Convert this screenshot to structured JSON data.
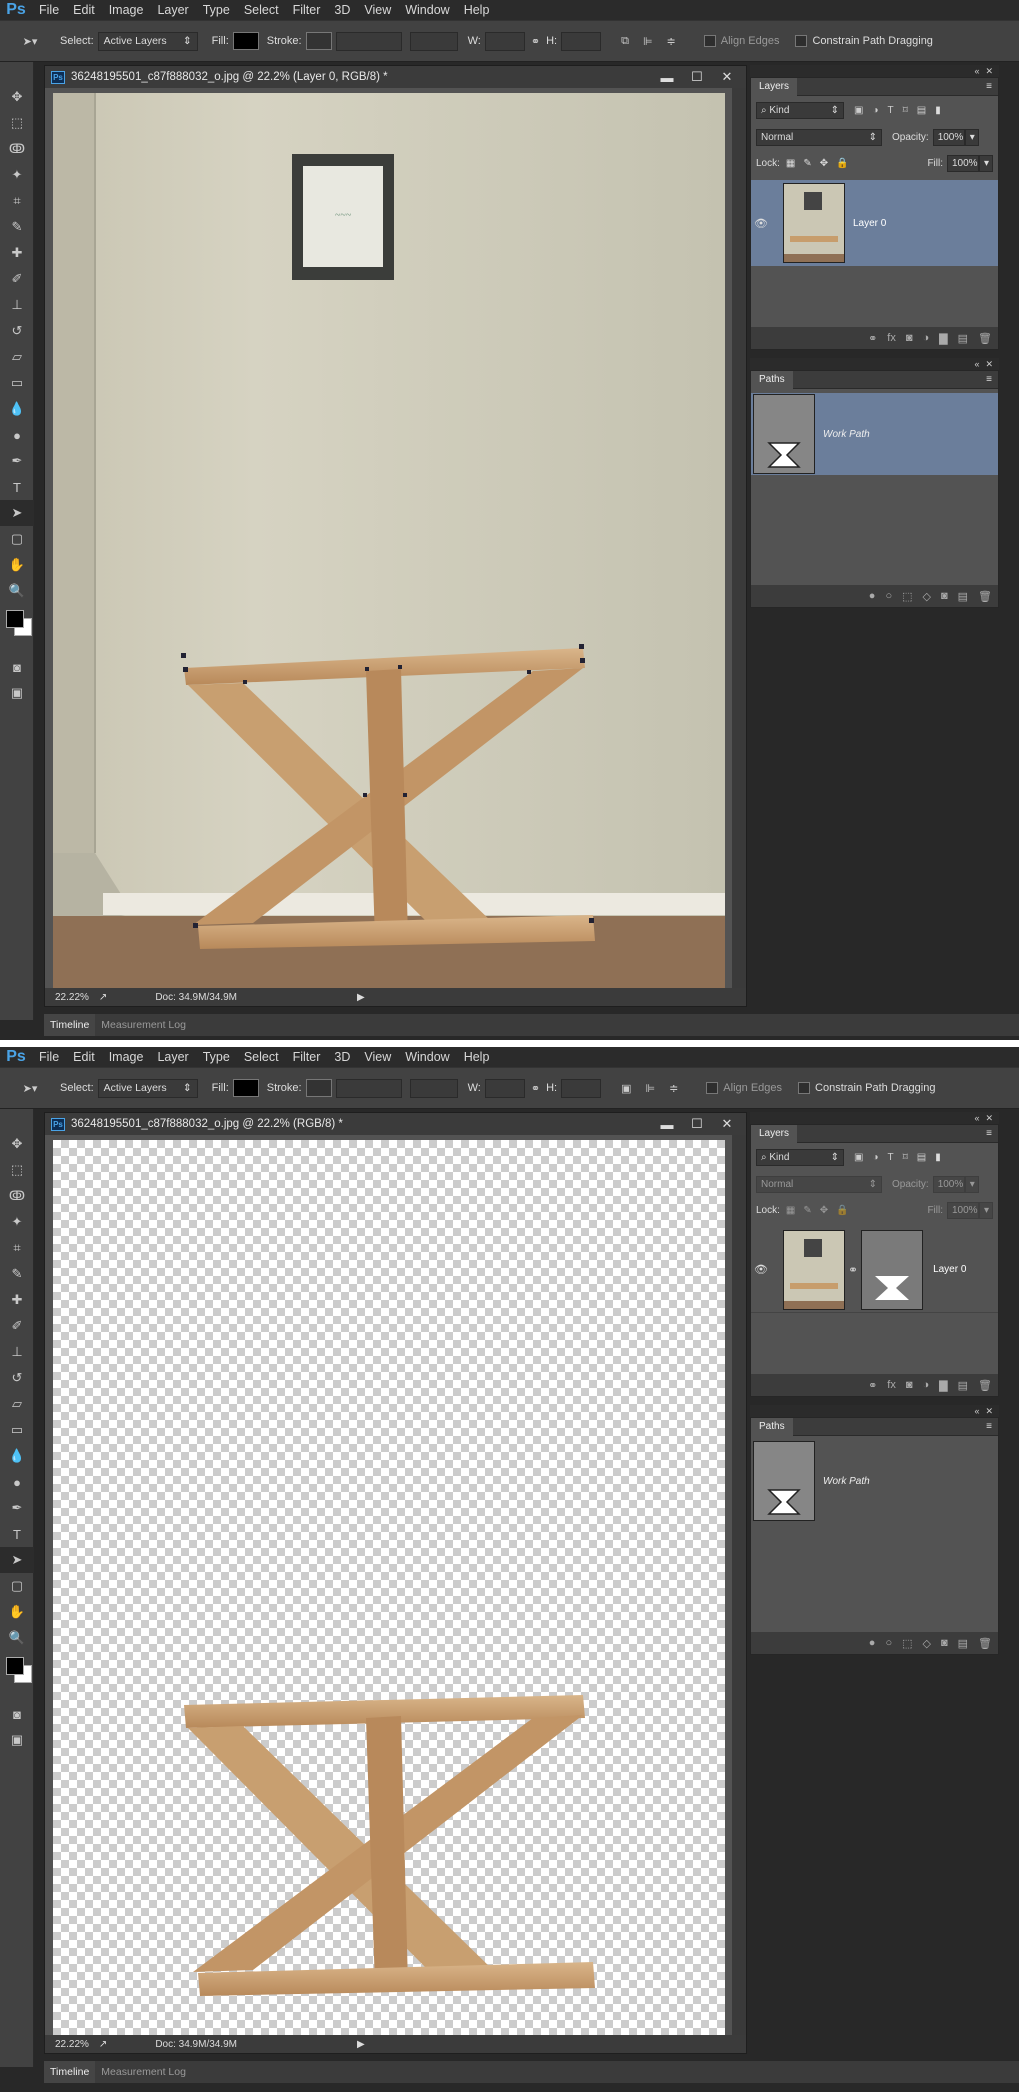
{
  "menu": [
    "File",
    "Edit",
    "Image",
    "Layer",
    "Type",
    "Select",
    "Filter",
    "3D",
    "View",
    "Window",
    "Help"
  ],
  "app_logo": "Ps",
  "options": {
    "select_label": "Select:",
    "select_value": "Active Layers",
    "fill_label": "Fill:",
    "stroke_label": "Stroke:",
    "w_label": "W:",
    "h_label": "H:",
    "align_edges": "Align Edges",
    "constrain": "Constrain Path Dragging"
  },
  "shot1": {
    "doc_title": "36248195501_c87f888032_o.jpg @ 22.2% (Layer 0, RGB/8) *",
    "zoom": "22.22%",
    "doc_size": "Doc: 34.9M/34.9M",
    "layers": {
      "kind": "Kind",
      "blend": "Normal",
      "opacity_label": "Opacity:",
      "opacity": "100%",
      "lock_label": "Lock:",
      "fill_label": "Fill:",
      "fill": "100%",
      "layer_name": "Layer 0"
    },
    "paths": {
      "tab": "Paths",
      "path_name": "Work Path"
    }
  },
  "shot2": {
    "doc_title": "36248195501_c87f888032_o.jpg @ 22.2% (RGB/8) *",
    "zoom": "22.22%",
    "doc_size": "Doc: 34.9M/34.9M",
    "layers": {
      "kind": "Kind",
      "blend": "Normal",
      "opacity_label": "Opacity:",
      "opacity": "100%",
      "lock_label": "Lock:",
      "fill_label": "Fill:",
      "fill": "100%",
      "layer_name": "Layer 0"
    },
    "paths": {
      "tab": "Paths",
      "path_name": "Work Path"
    }
  },
  "panels": {
    "layers_tab": "Layers"
  },
  "bottom_tabs": [
    "Timeline",
    "Measurement Log"
  ],
  "icons": {
    "tools": [
      "move-icon",
      "marquee-icon",
      "lasso-icon",
      "magic-wand-icon",
      "crop-icon",
      "eyedropper-icon",
      "healing-brush-icon",
      "brush-icon",
      "clone-stamp-icon",
      "history-brush-icon",
      "eraser-icon",
      "gradient-icon",
      "blur-icon",
      "dodge-icon",
      "pen-icon",
      "type-icon",
      "path-selection-icon",
      "rectangle-icon",
      "hand-icon",
      "zoom-icon"
    ]
  },
  "colors": {
    "accent": "#4aa3e6",
    "selected_layer": "#6b7e9b",
    "workspace": "#282828"
  }
}
